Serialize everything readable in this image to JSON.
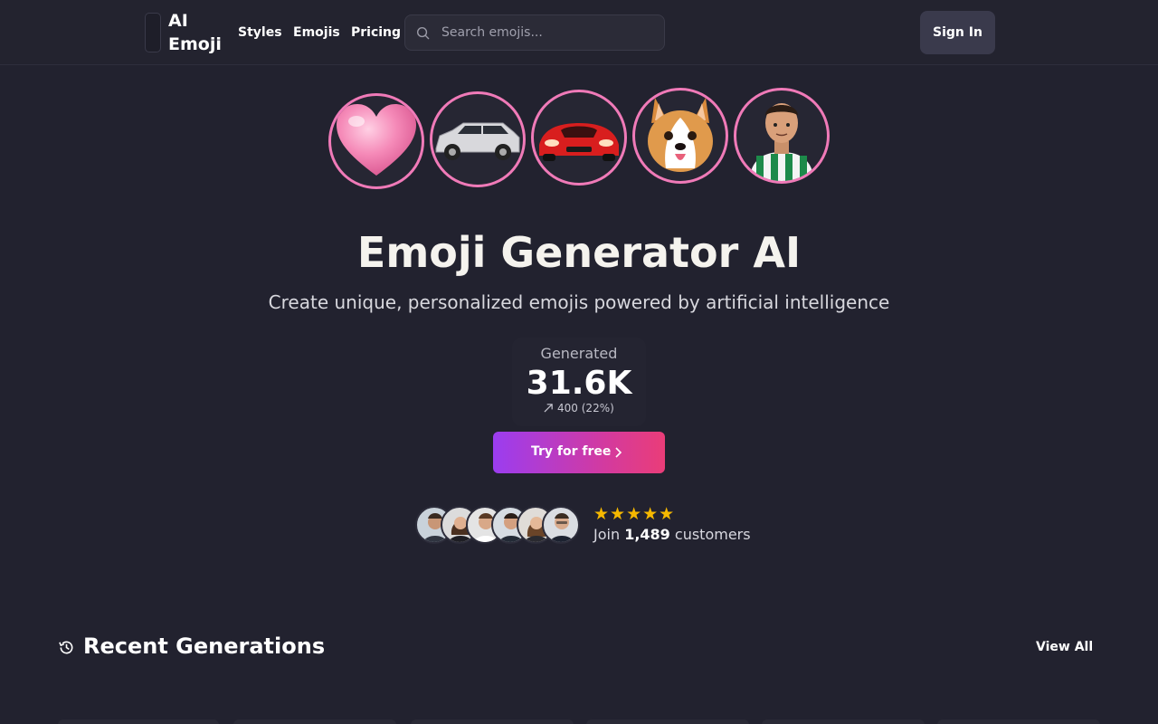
{
  "header": {
    "logo_line1": "AI",
    "logo_line2": "Emoji",
    "nav": [
      "Styles",
      "Emojis",
      "Pricing"
    ],
    "search_placeholder": "Search emojis...",
    "signin_label": "Sign In"
  },
  "emoji_circles": [
    "heart-emoji",
    "suv-car-emoji",
    "red-sports-car-emoji",
    "corgi-dog-emoji",
    "soccer-player-emoji"
  ],
  "hero": {
    "title": "Emoji Generator AI",
    "subtitle": "Create unique, personalized emojis powered by artificial intelligence"
  },
  "stat": {
    "label": "Generated",
    "value": "31.6K",
    "change": "400 (22%)",
    "change_icon": "trend-up-arrow"
  },
  "cta": {
    "label": "Try for free",
    "gradient": [
      "#9b3df0",
      "#ea3d78"
    ]
  },
  "social_proof": {
    "avatar_count": 6,
    "stars": "★★★★★",
    "join_prefix": "Join",
    "join_count": "1,489",
    "join_suffix": "customers"
  },
  "recent": {
    "title": "Recent Generations",
    "view_all": "View All",
    "icon": "history-icon"
  },
  "colors": {
    "background": "#22222f",
    "accent_pink": "#f07ab8",
    "star": "#f5b800"
  }
}
